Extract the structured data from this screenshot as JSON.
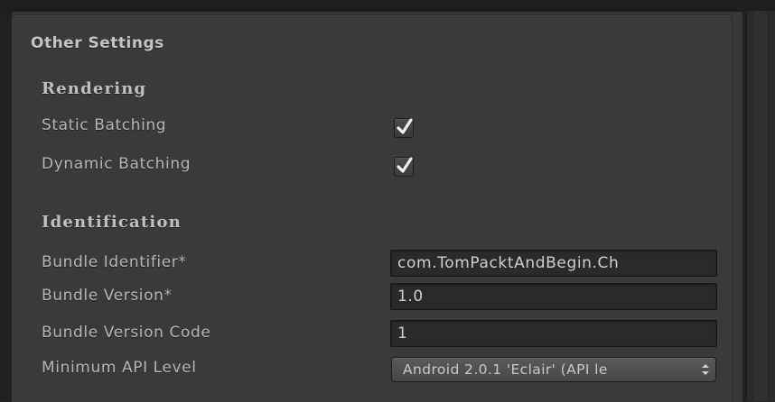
{
  "panel": {
    "title": "Other Settings"
  },
  "rendering": {
    "header": "Rendering",
    "static_batching": {
      "label": "Static Batching",
      "checked": true
    },
    "dynamic_batching": {
      "label": "Dynamic Batching",
      "checked": true
    }
  },
  "identification": {
    "header": "Identification",
    "bundle_identifier": {
      "label": "Bundle Identifier*",
      "value": "com.TomPacktAndBegin.Ch"
    },
    "bundle_version": {
      "label": "Bundle Version*",
      "value": "1.0"
    },
    "bundle_version_code": {
      "label": "Bundle Version Code",
      "value": "1"
    },
    "minimum_api_level": {
      "label": "Minimum API Level",
      "value": "Android 2.0.1 'Eclair' (API le"
    }
  },
  "icons": {
    "checkmark": "checkmark-icon",
    "popup_arrows": "up-down-arrows-icon"
  },
  "colors": {
    "panel_bg": "#3a3a3a",
    "field_bg": "#2a2a2a",
    "text": "#b6b6b6"
  }
}
